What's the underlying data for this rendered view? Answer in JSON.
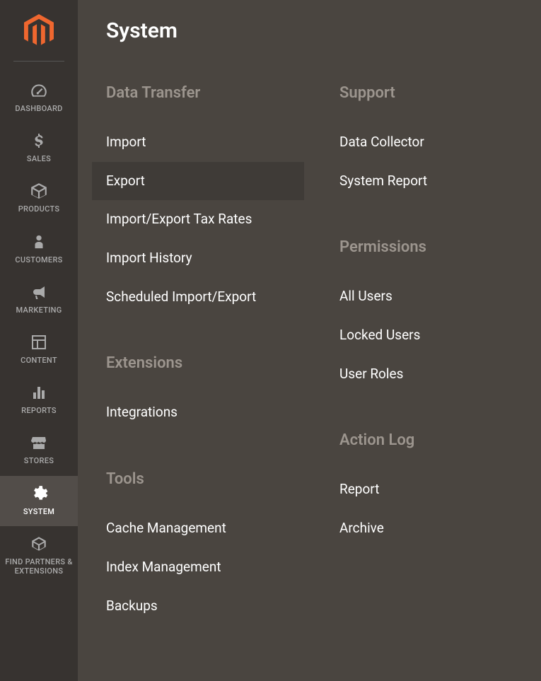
{
  "sidebar": {
    "items": [
      {
        "id": "dashboard",
        "label": "DASHBOARD"
      },
      {
        "id": "sales",
        "label": "SALES"
      },
      {
        "id": "products",
        "label": "PRODUCTS"
      },
      {
        "id": "customers",
        "label": "CUSTOMERS"
      },
      {
        "id": "marketing",
        "label": "MARKETING"
      },
      {
        "id": "content",
        "label": "CONTENT"
      },
      {
        "id": "reports",
        "label": "REPORTS"
      },
      {
        "id": "stores",
        "label": "STORES"
      },
      {
        "id": "system",
        "label": "SYSTEM"
      },
      {
        "id": "find-partners",
        "label": "FIND PARTNERS & EXTENSIONS"
      }
    ],
    "active": "system"
  },
  "flyout": {
    "title": "System",
    "columns": [
      {
        "groups": [
          {
            "title": "Data Transfer",
            "items": [
              {
                "label": "Import"
              },
              {
                "label": "Export",
                "highlight": true
              },
              {
                "label": "Import/Export Tax Rates"
              },
              {
                "label": "Import History"
              },
              {
                "label": "Scheduled Import/Export"
              }
            ]
          },
          {
            "title": "Extensions",
            "items": [
              {
                "label": "Integrations"
              }
            ]
          },
          {
            "title": "Tools",
            "items": [
              {
                "label": "Cache Management"
              },
              {
                "label": "Index Management"
              },
              {
                "label": "Backups"
              }
            ]
          }
        ]
      },
      {
        "groups": [
          {
            "title": "Support",
            "items": [
              {
                "label": "Data Collector"
              },
              {
                "label": "System Report"
              }
            ]
          },
          {
            "title": "Permissions",
            "items": [
              {
                "label": "All Users"
              },
              {
                "label": "Locked Users"
              },
              {
                "label": "User Roles"
              }
            ]
          },
          {
            "title": "Action Log",
            "items": [
              {
                "label": "Report"
              },
              {
                "label": "Archive"
              }
            ]
          }
        ]
      }
    ]
  }
}
